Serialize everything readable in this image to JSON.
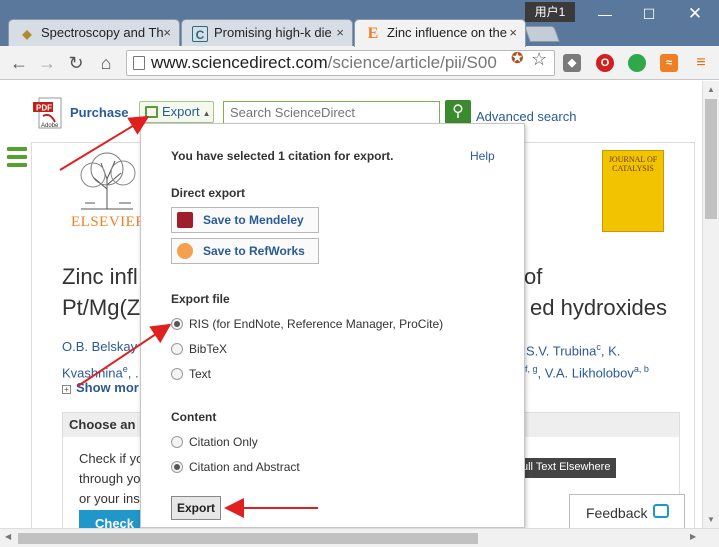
{
  "window": {
    "tabs": [
      {
        "title": "Spectroscopy and Th",
        "favicon": "diamond-icon"
      },
      {
        "title": "Promising high-k die",
        "favicon": "c-logo-icon"
      },
      {
        "title": "Zinc influence on the",
        "favicon": "elsevier-e-icon",
        "active": true
      }
    ],
    "user_label": "用户1",
    "close_glyph": "×"
  },
  "toolbar": {
    "url_host": "www.sciencedirect.com",
    "url_path": "/science/article/pii/S00"
  },
  "header": {
    "purchase_label": "Purchase",
    "pdf_label": "PDF",
    "adobe_label": "Adobe",
    "export_label": "Export",
    "search_placeholder": "Search ScienceDirect",
    "advanced_search_label": "Advanced search"
  },
  "article": {
    "publisher": "ELSEVIER",
    "journal_cover": "JOURNAL OF CATALYSIS",
    "title_line1_left": "Zinc infl",
    "title_line1_right": "of",
    "title_line2_left": "Pt/Mg(Z",
    "title_line2_right": "ed hydroxides",
    "authors_line1_left": "O.B. Belskay",
    "authors_line1_right": "S.V. Trubina",
    "authors_line1_sup": "c",
    "authors_line1_end": ", K.",
    "authors_line2_left": "Kvashnina",
    "authors_line2_sup": "e",
    "authors_line2_mid": ", .",
    "authors_line2_right_sup": "f, g",
    "authors_line2_right": ", V.A. Likholobov",
    "authors_line2_right_sup2": "a, b",
    "show_more": "Show mor",
    "choose_heading": "Choose an",
    "check_lines": [
      "Check if yo",
      "through yo",
      "or your ins"
    ],
    "check_button": "Check a",
    "full_text_elsewhere": "ull Text Elsewhere",
    "feedback_label": "Feedback"
  },
  "export_dropdown": {
    "selected_message": "You have selected 1 citation for export.",
    "help_label": "Help",
    "direct_export_heading": "Direct export",
    "mendeley_label": "Save to Mendeley",
    "refworks_label": "Save to RefWorks",
    "export_file_heading": "Export file",
    "file_options": [
      {
        "label": "RIS (for EndNote, Reference Manager, ProCite)",
        "selected": true
      },
      {
        "label": "BibTeX",
        "selected": false
      },
      {
        "label": "Text",
        "selected": false
      }
    ],
    "content_heading": "Content",
    "content_options": [
      {
        "label": "Citation Only",
        "selected": false
      },
      {
        "label": "Citation and Abstract",
        "selected": true
      }
    ],
    "export_button": "Export"
  },
  "annotation_color": "#e02020"
}
